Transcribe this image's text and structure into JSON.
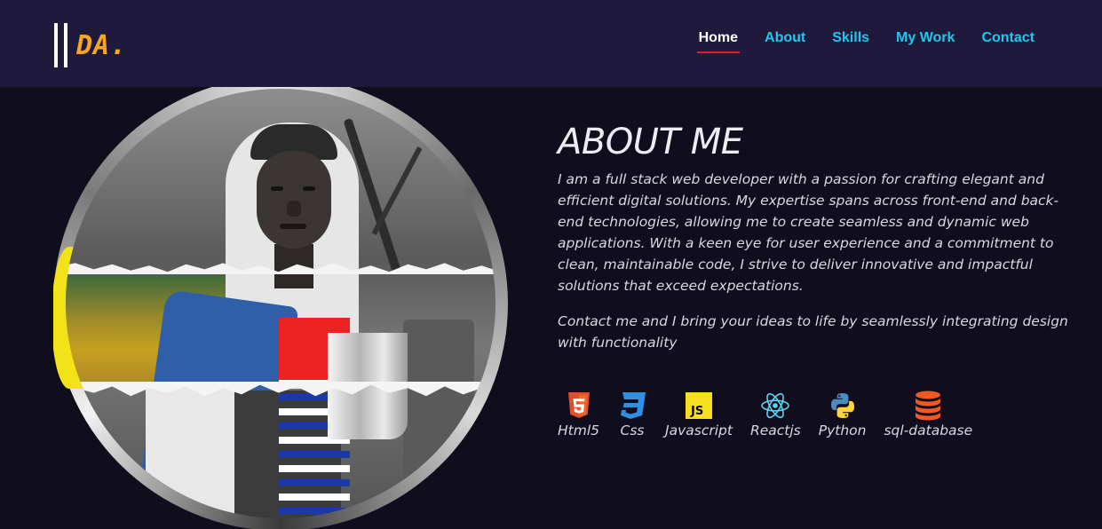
{
  "logo": {
    "text": "DA."
  },
  "nav": {
    "items": [
      {
        "label": "Home",
        "active": true
      },
      {
        "label": "About",
        "active": false
      },
      {
        "label": "Skills",
        "active": false
      },
      {
        "label": "My Work",
        "active": false
      },
      {
        "label": "Contact",
        "active": false
      }
    ]
  },
  "about": {
    "title": "ABOUT ME",
    "paragraph1": "I am a full stack web developer with a passion for crafting elegant and efficient digital solutions. My expertise spans across front-end and back-end technologies, allowing me to create seamless and dynamic web applications. With a keen eye for user experience and a commitment to clean, maintainable code, I strive to deliver innovative and impactful solutions that exceed expectations.",
    "paragraph2": "Contact me and I bring your ideas to life by seamlessly integrating design with functionality"
  },
  "skills": [
    {
      "label": "Html5",
      "icon": "html5-icon",
      "color": "#e34c26"
    },
    {
      "label": "Css",
      "icon": "css3-icon",
      "color": "#2f8fe0"
    },
    {
      "label": "Javascript",
      "icon": "javascript-icon",
      "color": "#f7df1e"
    },
    {
      "label": "Reactjs",
      "icon": "react-icon",
      "color": "#5ed3f3"
    },
    {
      "label": "Python",
      "icon": "python-icon",
      "color": "#4b8bbe"
    },
    {
      "label": "sql-database",
      "icon": "database-icon",
      "color": "#f05a22"
    }
  ],
  "colors": {
    "navbar_bg": "#1f1a3b",
    "page_bg": "#100d1c",
    "nav_link": "#1ec8f0",
    "nav_active_underline": "#e31b2e",
    "logo_accent": "#f6a623"
  }
}
